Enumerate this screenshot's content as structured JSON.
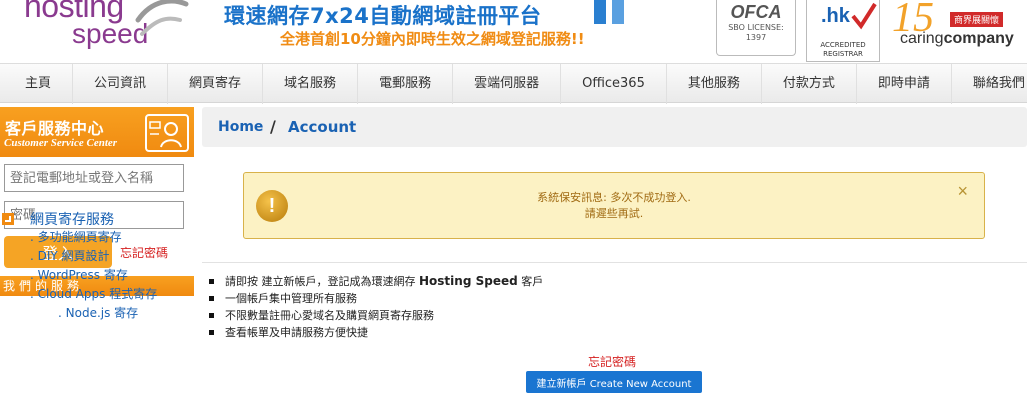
{
  "header": {
    "logo_top": "hosting",
    "logo_bottom": "speed",
    "slogan_main": "環速網存7x24自動網域註冊平台",
    "slogan_sub": "全港首創10分鐘內即時生效之網域登記服務!!",
    "ofca": {
      "title": "OFCA",
      "line1": "SBO LICENSE:",
      "line2": "1397"
    },
    "hk": {
      "title": ".hk",
      "line1": "ACCREDITED",
      "line2": "REGISTRAR"
    },
    "caring": {
      "number": "15",
      "tag": "商界展關懷",
      "brand_a": "caring",
      "brand_b": "company"
    }
  },
  "nav": {
    "items": [
      "主頁",
      "公司資訊",
      "網頁寄存",
      "域名服務",
      "電郵服務",
      "雲端伺服器",
      "Office365",
      "其他服務",
      "付款方式",
      "即時申請",
      "聯絡我們"
    ]
  },
  "sidebar": {
    "csc_title": "客戶服務中心",
    "csc_subtitle": "Customer Service Center",
    "email_placeholder": "登記電郵地址或登入名稱",
    "password_placeholder": "密碼",
    "login_label": "登入",
    "forgot_label": "忘記密碼",
    "services_title": "我們的服務",
    "service_group_title": "網頁寄存服務",
    "service_items": [
      ". 多功能網頁寄存",
      ". DIY 網頁設計",
      ". WordPress 寄存",
      ". Cloud Apps 程式寄存",
      ". Node.js 寄存"
    ]
  },
  "main": {
    "breadcrumb_home": "Home",
    "breadcrumb_sep": "/",
    "breadcrumb_current": "Account",
    "alert_icon": "!",
    "alert_line1": "系統保安訊息: 多次不成功登入.",
    "alert_line2": "請遲些再試.",
    "alert_close": "×",
    "benefit_1_pre": "請即按 建立新帳戶，登記成為環速網存 ",
    "benefit_1_brand": "Hosting Speed",
    "benefit_1_post": " 客戶",
    "benefit_2": "一個帳戶集中管理所有服務",
    "benefit_3": "不限數量註冊心愛域名及購買網頁寄存服務",
    "benefit_4": "查看帳單及申請服務方便快捷",
    "forgot_label": "忘記密碼",
    "create_label": "建立新帳戶 Create New Account"
  },
  "colors": {
    "brand_purple": "#8a3a8f",
    "orange": "#f08a10",
    "link_blue": "#1a62b3",
    "alert_bg": "#fcf2c4",
    "error_red": "#d51f1f",
    "button_blue": "#1a75d1"
  }
}
